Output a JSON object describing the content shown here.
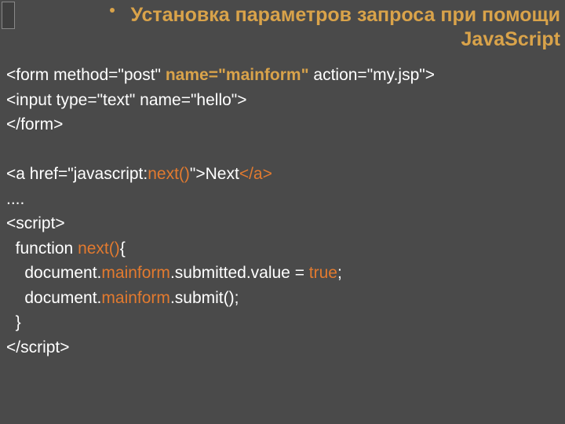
{
  "title": "Установка параметров запроса при помощи JavaScript",
  "code": {
    "l1a": "<form method=\"post\" ",
    "l1b": "name=\"mainform\"",
    "l1c": " action=\"my.jsp\">",
    "l2": "<input type=\"text\" name=\"hello\">",
    "l3": "</form>",
    "l4": "",
    "l5a": "<a href=\"javascript:",
    "l5b": "next()",
    "l5c": "\">Next",
    "l5d": "</a>",
    "l6": "....",
    "l7": "<script>",
    "l8a": "  function ",
    "l8b": "next()",
    "l8c": "{",
    "l9a": "    document.",
    "l9b": "mainform",
    "l9c": ".submitted.value = ",
    "l9d": "true",
    "l9e": ";",
    "l10a": "    document.",
    "l10b": "mainform",
    "l10c": ".submit();",
    "l11": "  }",
    "l12": "</script>"
  }
}
